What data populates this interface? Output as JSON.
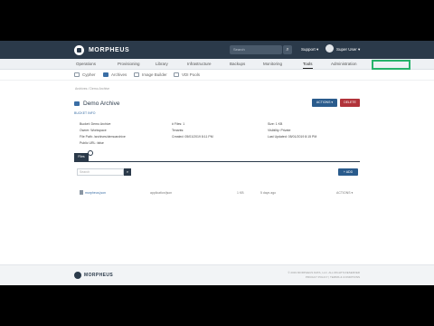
{
  "topbar": {
    "brand": "MORPHEUS",
    "search_placeholder": "Search",
    "support": "Support ▾",
    "user": "Super User ▾"
  },
  "menu": [
    "Operations",
    "Provisioning",
    "Library",
    "Infrastructure",
    "Backups",
    "Monitoring",
    "Tools",
    "Administration"
  ],
  "subnav": [
    "Cypher",
    "Archives",
    "Image Builder",
    "VDI Pools"
  ],
  "breadcrumb": "Archives  /  Demo Archive",
  "page": {
    "title": "Demo Archive",
    "sublink": "BUCKET INFO",
    "actions": "ACTIONS ▾",
    "delete": "DELETE"
  },
  "details": {
    "bucket": "Bucket: Demo Archive",
    "owner": "Owner: Workspace",
    "filepath": "File Path: /archives/demoarchive",
    "public_url": "Public URL: false",
    "files": "# Files: 1",
    "tenants": "Tenants:",
    "created": "Created: 05/01/2019 8:11 PM",
    "size": "Size: 1 KB",
    "visibility": "Visibility: Private",
    "last_updated": "Last Updated: 05/01/2019 8:15 PM"
  },
  "tabs": {
    "files": "Files"
  },
  "files_panel": {
    "search_placeholder": "Search",
    "add_button": "+ ADD",
    "rows": [
      {
        "name": "morpheus.json",
        "type": "application/json",
        "size": "1 KB",
        "date": "5 days ago",
        "action": "ACTIONS ▾"
      }
    ]
  },
  "footer": {
    "brand": "MORPHEUS",
    "copyright": "© 2019 MORPHEUS DATA, LLC. ALL RIGHTS RESERVED",
    "links": "PRIVACY POLICY  |  TERMS & CONDITIONS"
  }
}
